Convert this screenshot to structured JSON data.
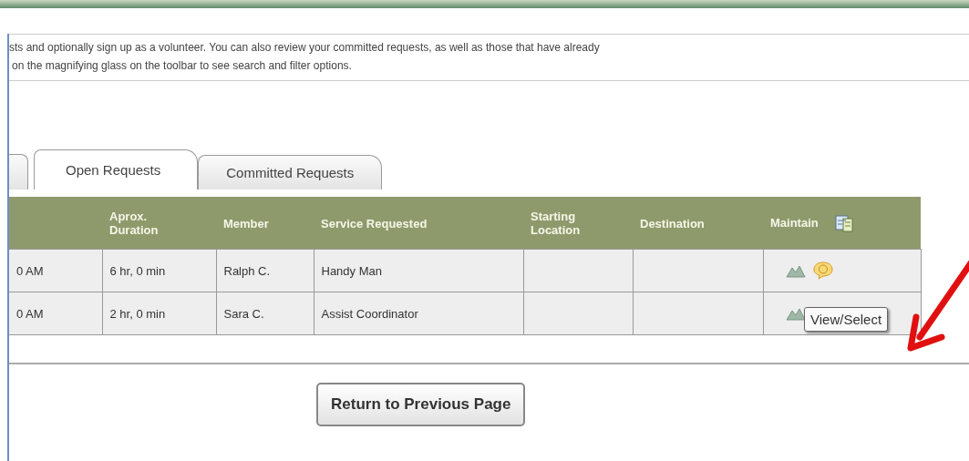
{
  "description": [
    "sts and optionally sign up as a volunteer. You can also review your committed requests, as well as those that have already",
    "on the magnifying glass on the toolbar to see search and filter options."
  ],
  "tabs": [
    {
      "label": "Open Requests",
      "selected": true
    },
    {
      "label": "Committed Requests",
      "selected": false
    }
  ],
  "table": {
    "columns": [
      "",
      "Aprox.\nDuration",
      "Member",
      "Service Requested",
      "Starting\nLocation",
      "Destination",
      "Maintain"
    ],
    "rows": [
      {
        "cells": [
          "0 AM",
          "6 hr, 0 min",
          "Ralph C.",
          "Handy Man",
          "",
          ""
        ]
      },
      {
        "cells": [
          "0 AM",
          "2 hr, 0 min",
          "Sara C.",
          "Assist Coordinator",
          "",
          ""
        ]
      }
    ]
  },
  "tooltip": "View/Select",
  "button": "Return to Previous Page"
}
